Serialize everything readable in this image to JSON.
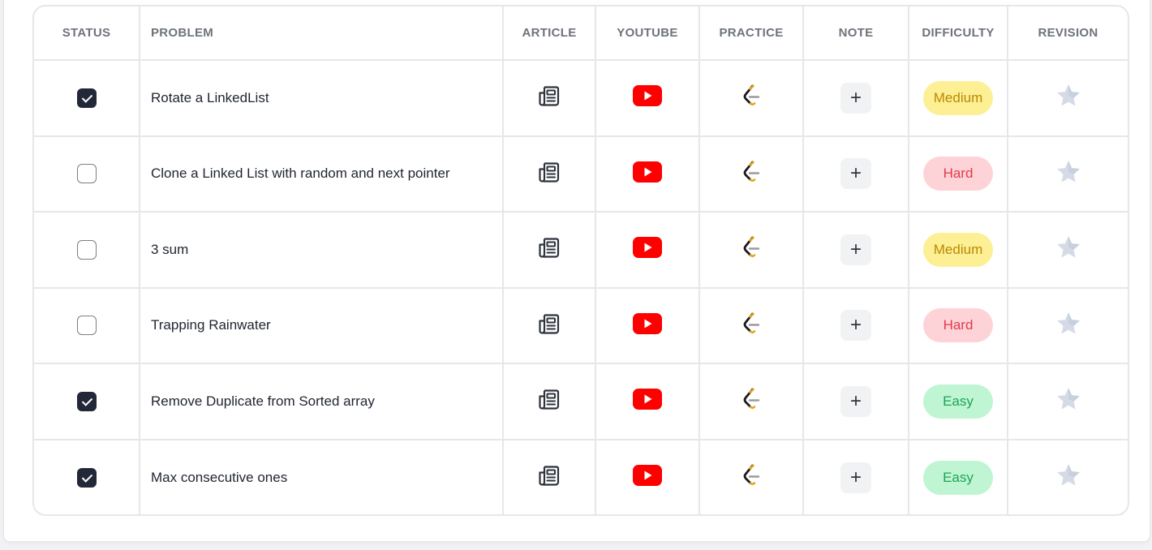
{
  "table": {
    "headers": {
      "status": "STATUS",
      "problem": "PROBLEM",
      "article": "ARTICLE",
      "youtube": "YOUTUBE",
      "practice": "PRACTICE",
      "note": "NOTE",
      "difficulty": "DIFFICULTY",
      "revision": "REVISION"
    },
    "rows": [
      {
        "checked": true,
        "problem": "Rotate a LinkedList",
        "difficulty": "Medium",
        "level": "medium"
      },
      {
        "checked": false,
        "problem": "Clone a Linked List with random and next pointer",
        "difficulty": "Hard",
        "level": "hard"
      },
      {
        "checked": false,
        "problem": "3 sum",
        "difficulty": "Medium",
        "level": "medium"
      },
      {
        "checked": false,
        "problem": "Trapping Rainwater",
        "difficulty": "Hard",
        "level": "hard"
      },
      {
        "checked": true,
        "problem": "Remove Duplicate from Sorted array",
        "difficulty": "Easy",
        "level": "easy"
      },
      {
        "checked": true,
        "problem": "Max consecutive ones",
        "difficulty": "Easy",
        "level": "easy"
      }
    ]
  },
  "icons": {
    "article": "article-icon",
    "youtube": "youtube-icon",
    "practice": "leetcode-icon",
    "note": "plus-icon",
    "revision": "star-icon"
  },
  "note_symbol": "+",
  "colors": {
    "checkbox_checked": "#232838",
    "youtube_red": "#ff0000",
    "medium_bg": "#fcef94",
    "hard_bg": "#fdd3d8",
    "easy_bg": "#bff5d2",
    "star": "#d5dbe6"
  }
}
